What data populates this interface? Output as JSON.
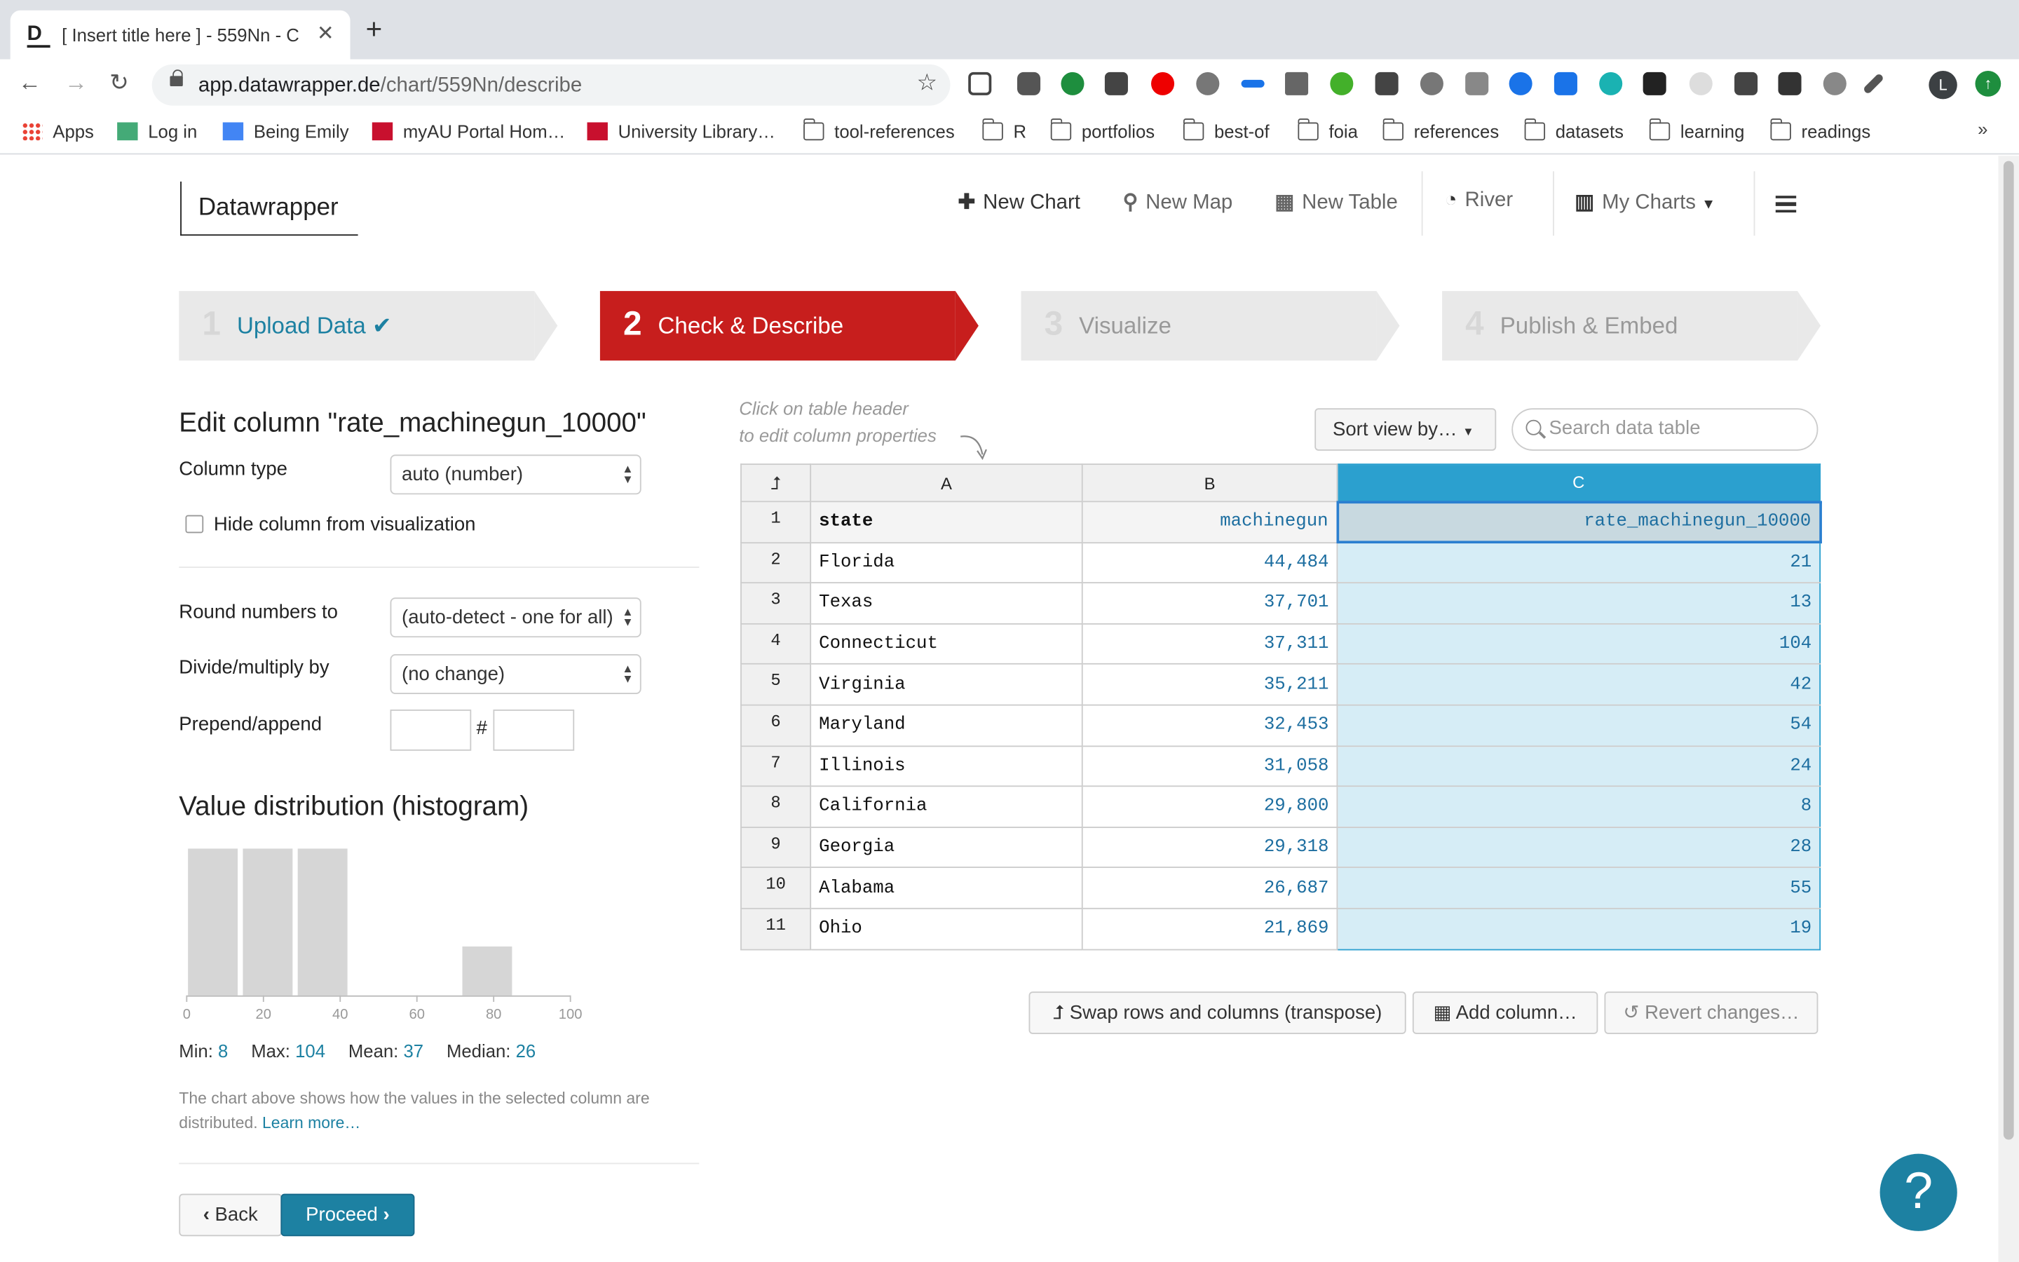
{
  "browser": {
    "tab_title": "[ Insert title here ] - 559Nn - C",
    "url_host": "app.datawrapper.de",
    "url_path": "/chart/559Nn/describe",
    "profile_initial": "L",
    "bookmarks": [
      "Apps",
      "Log in",
      "Being Emily",
      "myAU Portal Hom…",
      "University Library…",
      "tool-references",
      "R",
      "portfolios",
      "best-of",
      "foia",
      "references",
      "datasets",
      "learning",
      "readings"
    ]
  },
  "app": {
    "logo": "Datawrapper",
    "nav": {
      "new_chart": "New Chart",
      "new_map": "New Map",
      "new_table": "New Table",
      "river": "River",
      "my_charts": "My Charts"
    },
    "steps": [
      {
        "num": "1",
        "label": "Upload Data"
      },
      {
        "num": "2",
        "label": "Check & Describe"
      },
      {
        "num": "3",
        "label": "Visualize"
      },
      {
        "num": "4",
        "label": "Publish & Embed"
      }
    ],
    "edit": {
      "heading": "Edit column \"rate_machinegun_10000\"",
      "column_type_label": "Column type",
      "column_type_value": "auto (number)",
      "hide_label": "Hide column from visualization",
      "round_label": "Round numbers to",
      "round_value": "(auto-detect - one for all)",
      "divide_label": "Divide/multiply by",
      "divide_value": "(no change)",
      "prepend_label": "Prepend/append",
      "hash": "#"
    },
    "histogram": {
      "heading": "Value distribution (histogram)",
      "ticks": [
        "0",
        "20",
        "40",
        "60",
        "80",
        "100"
      ],
      "bins": [
        3,
        3,
        3,
        0,
        0,
        1,
        0
      ],
      "min_label": "Min:",
      "min": "8",
      "max_label": "Max:",
      "max": "104",
      "mean_label": "Mean:",
      "mean": "37",
      "median_label": "Median:",
      "median": "26",
      "note": "The chart above shows how the values in the selected column are distributed.",
      "learn_more": "Learn more…"
    },
    "buttons": {
      "back": "Back",
      "proceed": "Proceed",
      "transpose": "Swap rows and columns (transpose)",
      "add_column": "Add column…",
      "revert": "Revert changes…",
      "sort": "Sort view by…"
    },
    "hint_line1": "Click on table header",
    "hint_line2": "to edit column properties",
    "search_placeholder": "Search data table",
    "table": {
      "columns": [
        "A",
        "B",
        "C"
      ],
      "rows": [
        [
          "1",
          "state",
          "machinegun",
          "rate_machinegun_10000"
        ],
        [
          "2",
          "Florida",
          "44,484",
          "21"
        ],
        [
          "3",
          "Texas",
          "37,701",
          "13"
        ],
        [
          "4",
          "Connecticut",
          "37,311",
          "104"
        ],
        [
          "5",
          "Virginia",
          "35,211",
          "42"
        ],
        [
          "6",
          "Maryland",
          "32,453",
          "54"
        ],
        [
          "7",
          "Illinois",
          "31,058",
          "24"
        ],
        [
          "8",
          "California",
          "29,800",
          "8"
        ],
        [
          "9",
          "Georgia",
          "29,318",
          "28"
        ],
        [
          "10",
          "Alabama",
          "26,687",
          "55"
        ],
        [
          "11",
          "Ohio",
          "21,869",
          "19"
        ]
      ]
    },
    "help": "?"
  }
}
